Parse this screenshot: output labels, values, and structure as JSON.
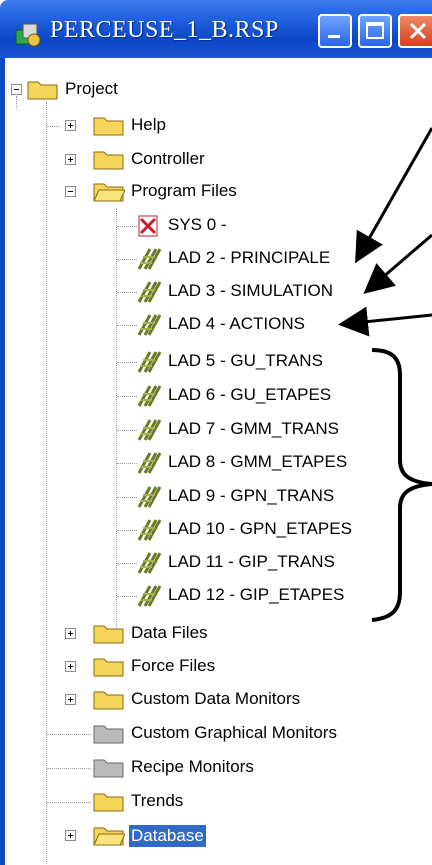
{
  "window": {
    "title": "PERCEUSE_1_B.RSP",
    "buttons": {
      "minimize": "minimize",
      "maximize": "maximize",
      "close": "close"
    }
  },
  "tree": {
    "root": "Project",
    "top_folders": {
      "help": "Help",
      "controller": "Controller",
      "program_files": "Program Files"
    },
    "program_items": [
      "SYS 0 -",
      "LAD 2 - PRINCIPALE",
      "LAD 3 - SIMULATION",
      "LAD 4 - ACTIONS",
      "LAD 5 - GU_TRANS",
      "LAD 6 - GU_ETAPES",
      "LAD 7 - GMM_TRANS",
      "LAD 8 - GMM_ETAPES",
      "LAD 9 - GPN_TRANS",
      "LAD 10 - GPN_ETAPES",
      "LAD 11 - GIP_TRANS",
      "LAD 12 - GIP_ETAPES"
    ],
    "bottom_folders": [
      "Data Files",
      "Force Files",
      "Custom Data Monitors",
      "Custom Graphical Monitors",
      "Recipe Monitors",
      "Trends",
      "Database"
    ],
    "selected": "Database"
  },
  "colors": {
    "titlebar": "#0b47c6",
    "selection": "#316ac5",
    "folder": "#f5d55a",
    "annotation": "#000000"
  }
}
